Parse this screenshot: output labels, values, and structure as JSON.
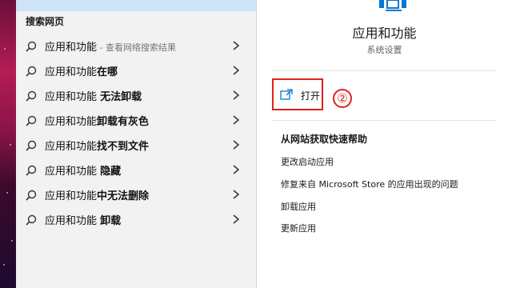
{
  "search_panel": {
    "section_title": "搜索网页",
    "results": [
      {
        "normal": "应用和功能",
        "bold": "",
        "suffix": " - 查看网络搜索结果"
      },
      {
        "normal": "应用和功能",
        "bold": "在哪",
        "suffix": ""
      },
      {
        "normal": "应用和功能 ",
        "bold": "无法卸载",
        "suffix": ""
      },
      {
        "normal": "应用和功能",
        "bold": "卸载有灰色",
        "suffix": ""
      },
      {
        "normal": "应用和功能",
        "bold": "找不到文件",
        "suffix": ""
      },
      {
        "normal": "应用和功能 ",
        "bold": "隐藏",
        "suffix": ""
      },
      {
        "normal": "应用和功能",
        "bold": "中无法删除",
        "suffix": ""
      },
      {
        "normal": "应用和功能 ",
        "bold": "卸载",
        "suffix": ""
      }
    ]
  },
  "details_panel": {
    "title": "应用和功能",
    "subtitle": "系统设置",
    "open_label": "打开",
    "step_marker": "②",
    "help_title": "从网站获取快速帮助",
    "help_links": [
      "更改启动应用",
      "修复来自 Microsoft Store 的应用出现的问题",
      "卸载应用",
      "更新应用"
    ]
  },
  "colors": {
    "accent": "#0078d4",
    "highlight_red": "#e02020",
    "selected_bg": "#cde3f7"
  },
  "icons": {
    "search": "search-icon",
    "chevron": "chevron-right-icon",
    "open": "open-external-icon",
    "app": "settings-app-icon"
  }
}
